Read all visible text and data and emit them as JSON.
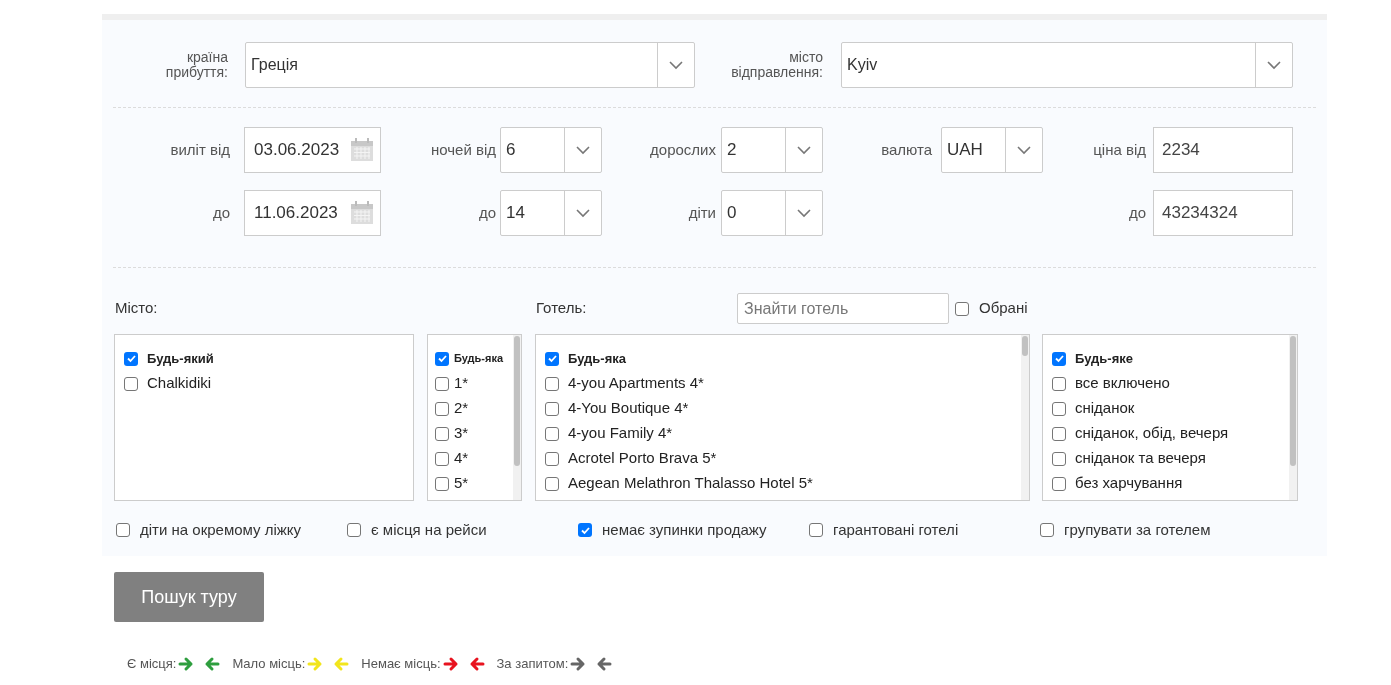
{
  "route": [
    {
      "label": "країна прибуття:",
      "value": "Греція"
    },
    {
      "label": "місто відправлення:",
      "value": "Kyiv"
    }
  ],
  "filters": [
    {
      "fields": [
        {
          "kind": "date",
          "label": "виліт від",
          "value": "03.06.2023"
        },
        {
          "kind": "date",
          "label": "до",
          "value": "11.06.2023"
        }
      ]
    },
    {
      "fields": [
        {
          "kind": "select",
          "label": "ночей від",
          "value": "6"
        },
        {
          "kind": "select",
          "label": "до",
          "value": "14"
        }
      ]
    },
    {
      "fields": [
        {
          "kind": "select",
          "label": "дорослих",
          "value": "2"
        },
        {
          "kind": "select",
          "label": "діти",
          "value": "0"
        }
      ]
    },
    {
      "fields": [
        {
          "kind": "select",
          "label": "валюта",
          "value": "UAH"
        }
      ]
    },
    {
      "fields": [
        {
          "kind": "input",
          "label": "ціна від",
          "value": "2234"
        },
        {
          "kind": "input",
          "label": "до",
          "value": "43234324"
        }
      ]
    }
  ],
  "city_title": "Місто:",
  "hotel_title": "Готель:",
  "hotel_search": {
    "placeholder": "Знайти готель"
  },
  "favorites": {
    "label": "Обрані",
    "checked": false
  },
  "lists": [
    {
      "items": [
        {
          "kind": "any",
          "label": "Будь-який",
          "checked": true
        },
        {
          "kind": "option",
          "label": "Chalkidiki",
          "checked": false
        }
      ]
    },
    {
      "items": [
        {
          "kind": "any",
          "label": "Будь-яка",
          "checked": true
        },
        {
          "kind": "option",
          "label": "1*",
          "checked": false
        },
        {
          "kind": "option",
          "label": "2*",
          "checked": false
        },
        {
          "kind": "option",
          "label": "3*",
          "checked": false
        },
        {
          "kind": "option",
          "label": "4*",
          "checked": false
        },
        {
          "kind": "option",
          "label": "5*",
          "checked": false
        }
      ]
    },
    {
      "items": [
        {
          "kind": "any",
          "label": "Будь-яка",
          "checked": true
        },
        {
          "kind": "option",
          "label": "4-you Apartments 4*",
          "checked": false
        },
        {
          "kind": "option",
          "label": "4-You Boutique 4*",
          "checked": false
        },
        {
          "kind": "option",
          "label": "4-you Family 4*",
          "checked": false
        },
        {
          "kind": "option",
          "label": "Acrotel Porto Brava 5*",
          "checked": false
        },
        {
          "kind": "option",
          "label": "Aegean Melathron Thalasso Hotel 5*",
          "checked": false
        }
      ]
    },
    {
      "items": [
        {
          "kind": "any",
          "label": "Будь-яке",
          "checked": true
        },
        {
          "kind": "option",
          "label": "все включено",
          "checked": false
        },
        {
          "kind": "option",
          "label": "сніданок",
          "checked": false
        },
        {
          "kind": "option",
          "label": "сніданок, обід, вечеря",
          "checked": false
        },
        {
          "kind": "option",
          "label": "сніданок та вечеря",
          "checked": false
        },
        {
          "kind": "option",
          "label": "без харчування",
          "checked": false
        }
      ]
    }
  ],
  "options": [
    {
      "label": "діти на окремому ліжку",
      "checked": false
    },
    {
      "label": "є місця на рейси",
      "checked": false
    },
    {
      "label": "немає зупинки продажу",
      "checked": true
    },
    {
      "label": "гарантовані готелі",
      "checked": false
    },
    {
      "label": "групувати за готелем",
      "checked": false
    }
  ],
  "search_button": "Пошук туру",
  "legend": [
    {
      "label": "Є місця:",
      "color": "#2e9e3e"
    },
    {
      "label": "Мало місць:",
      "color": "#f2e51c"
    },
    {
      "label": "Немає місць:",
      "color": "#e8131f"
    },
    {
      "label": "За запитом:",
      "color": "#666666"
    }
  ]
}
